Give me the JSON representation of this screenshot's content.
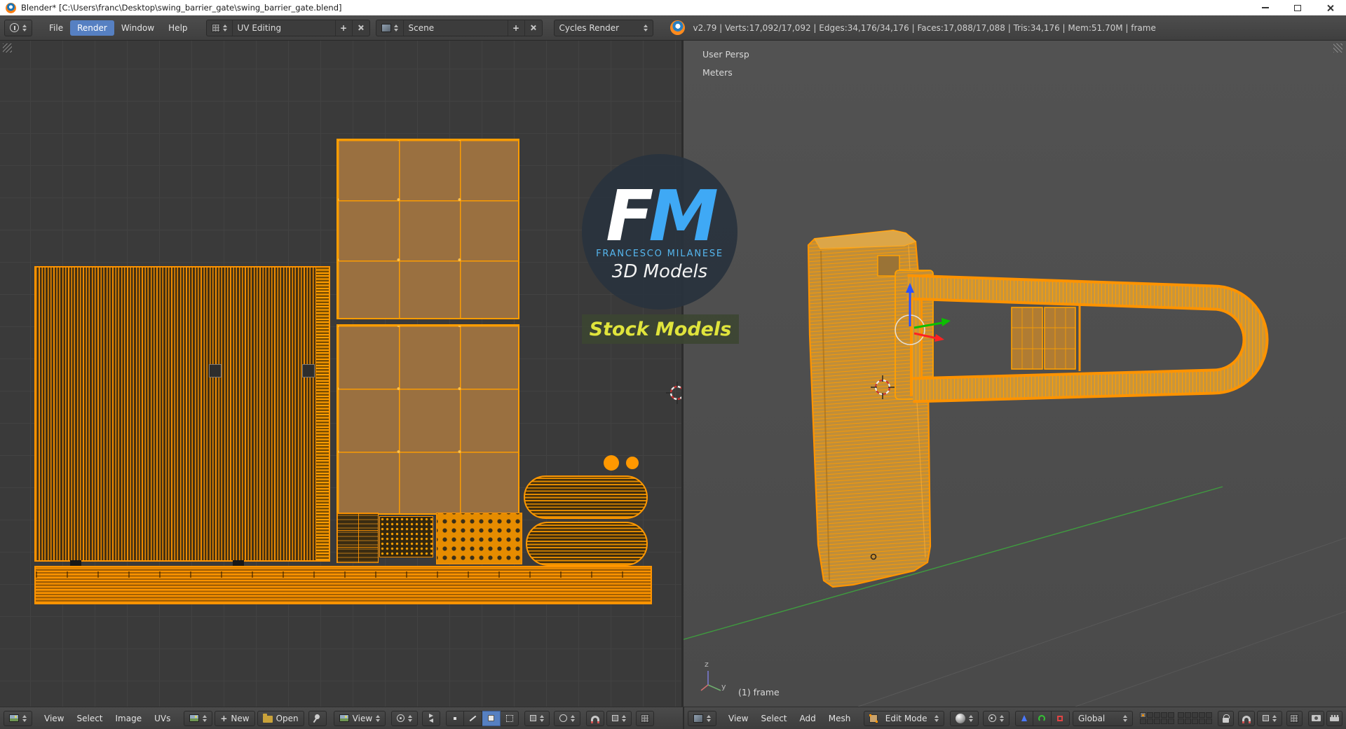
{
  "window": {
    "title": "Blender* [C:\\Users\\franc\\Desktop\\swing_barrier_gate\\swing_barrier_gate.blend]"
  },
  "info_bar": {
    "menu_file": "File",
    "menu_render": "Render",
    "menu_window": "Window",
    "menu_help": "Help",
    "layout_value": "UV Editing",
    "scene_value": "Scene",
    "engine_value": "Cycles Render",
    "stats": "v2.79 | Verts:17,092/17,092 | Edges:34,176/34,176 | Faces:17,088/17,088 | Tris:34,176 | Mem:51.70M | frame"
  },
  "uv_header": {
    "menu_view": "View",
    "menu_select": "Select",
    "menu_image": "Image",
    "menu_uvs": "UVs",
    "new_button": "New",
    "open_button": "Open",
    "display_dropdown": "View"
  },
  "v3d_header": {
    "menu_view": "View",
    "menu_select": "Select",
    "menu_add": "Add",
    "menu_mesh": "Mesh",
    "mode_value": "Edit Mode",
    "orientation_value": "Global"
  },
  "viewport": {
    "persp_label": "User Persp",
    "units_label": "Meters",
    "frame_label": "(1) frame",
    "axis_z": "z",
    "axis_y": "y"
  },
  "watermark": {
    "letter_f": "F",
    "letter_m": "M",
    "name": "FRANCESCO MILANESE",
    "line2": "3D Models",
    "badge": "Stock Models"
  },
  "icons": {
    "plus": "+"
  },
  "colors": {
    "wire_orange": "#ff9400",
    "active_blue": "#5680c2",
    "fm_blue": "#3fa9f5",
    "badge_text": "#e0e43c"
  }
}
